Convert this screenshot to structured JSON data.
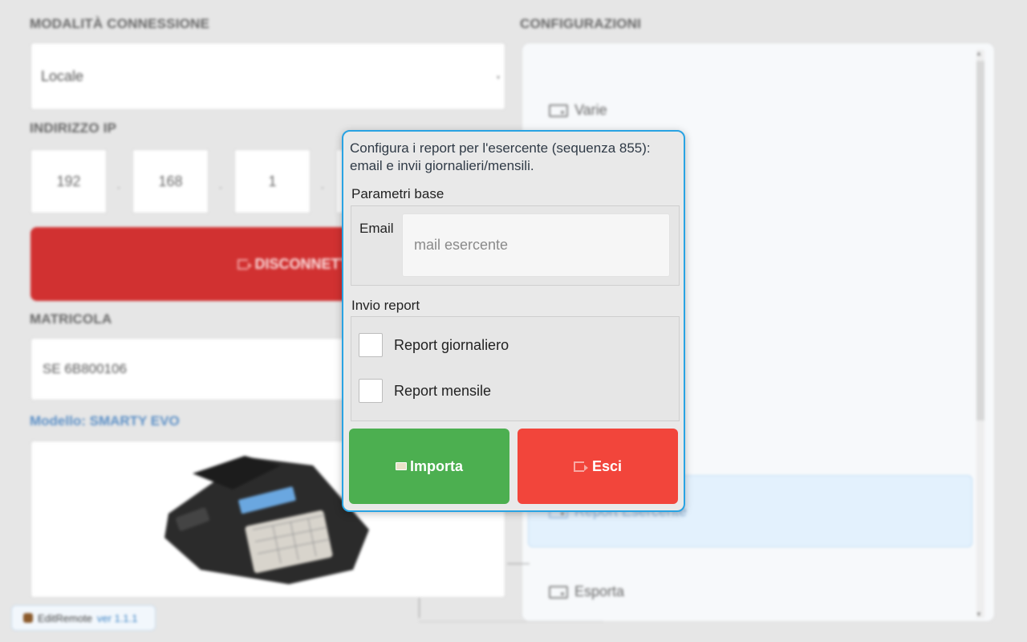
{
  "left": {
    "connection_title": "MODALITÀ CONNESSIONE",
    "connection_mode": "Locale",
    "ip_title": "INDIRIZZO IP",
    "ip": [
      "192",
      "168",
      "1"
    ],
    "disconnect_label": "DISCONNETTI",
    "matricola_title": "MATRICOLA",
    "matricola_value": "SE 6B800106",
    "model_label": "Modello: SMARTY EVO",
    "app_name": "EditRemote",
    "app_version": "ver 1.1.1"
  },
  "config": {
    "title": "CONFIGURAZIONI",
    "items": [
      "Varie",
      "Report Esercente",
      "Esporta"
    ]
  },
  "dialog": {
    "description": "Configura i report per l'esercente (sequenza 855): email e invii giornalieri/mensili.",
    "base_params_label": "Parametri base",
    "email_label": "Email",
    "email_placeholder": "mail esercente",
    "email_value": "",
    "report_send_label": "Invio report",
    "daily_report_label": "Report giornaliero",
    "daily_report_checked": false,
    "monthly_report_label": "Report mensile",
    "monthly_report_checked": false,
    "import_label": "Importa",
    "exit_label": "Esci"
  },
  "colors": {
    "dialog_border": "#29a3e3",
    "import_button": "#4caf50",
    "exit_button": "#f2453b",
    "disconnect_button": "#d13131",
    "highlight_item": "#e3f1fd"
  }
}
